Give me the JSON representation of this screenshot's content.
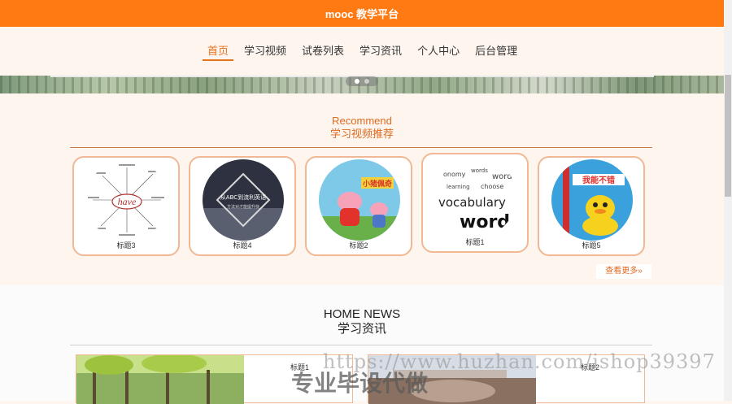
{
  "app": {
    "title": "mooc 教学平台"
  },
  "nav": {
    "items": [
      "首页",
      "学习视频",
      "试卷列表",
      "学习资讯",
      "个人中心",
      "后台管理"
    ],
    "active": "首页"
  },
  "recommend": {
    "title_en": "Recommend",
    "title_cn": "学习视频推荐",
    "cards": [
      {
        "title": "标题3",
        "image": "mindmap-have",
        "overlay": "have"
      },
      {
        "title": "标题4",
        "image": "abc-english",
        "overlay": "从ABC到流利英语",
        "overlay_sub": "方法对才能提升快"
      },
      {
        "title": "标题2",
        "image": "peppa-pig",
        "overlay": "小猪佩奇"
      },
      {
        "title": "标题1",
        "image": "vocabulary-word-cloud",
        "overlay": "vocabulary",
        "overlay2": "word"
      },
      {
        "title": "标题5",
        "image": "yellow-duck-book",
        "overlay": "我能不错"
      }
    ],
    "more_label": "查看更多»"
  },
  "news": {
    "title_en": "HOME NEWS",
    "title_cn": "学习资讯",
    "items": [
      {
        "title": "标题1"
      },
      {
        "title": "标题2"
      }
    ]
  },
  "watermark": {
    "url": "https://www.huzhan.com/ishop39397",
    "text": "专业毕设代做"
  },
  "colors": {
    "brand": "#ff7a13",
    "accent": "#e06a20",
    "card_border": "#f0b894",
    "page_bg": "#fdf5ee"
  }
}
